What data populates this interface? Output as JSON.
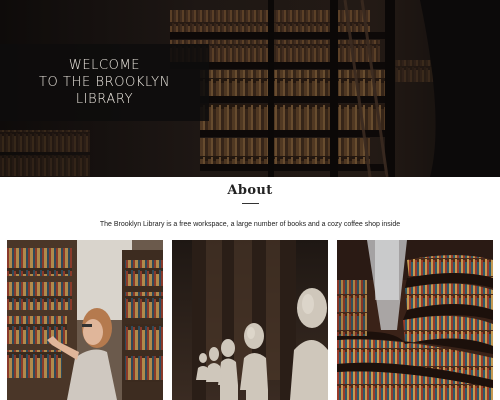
{
  "hero": {
    "title": "WELCOME\nTO THE BROOKLYN\nLIBRARY"
  },
  "about": {
    "heading": "About",
    "description": "The Brooklyn Library is a free workspace, a large number of books and a cozy coffee shop inside"
  },
  "gallery": {
    "photos": [
      {
        "subject": "woman-browsing-shelves"
      },
      {
        "subject": "marble-busts-hall"
      },
      {
        "subject": "round-library-shelves"
      }
    ]
  },
  "colors": {
    "hero_bg": "#18120f",
    "title_box": "#0e0c0c",
    "text": "#222222"
  }
}
